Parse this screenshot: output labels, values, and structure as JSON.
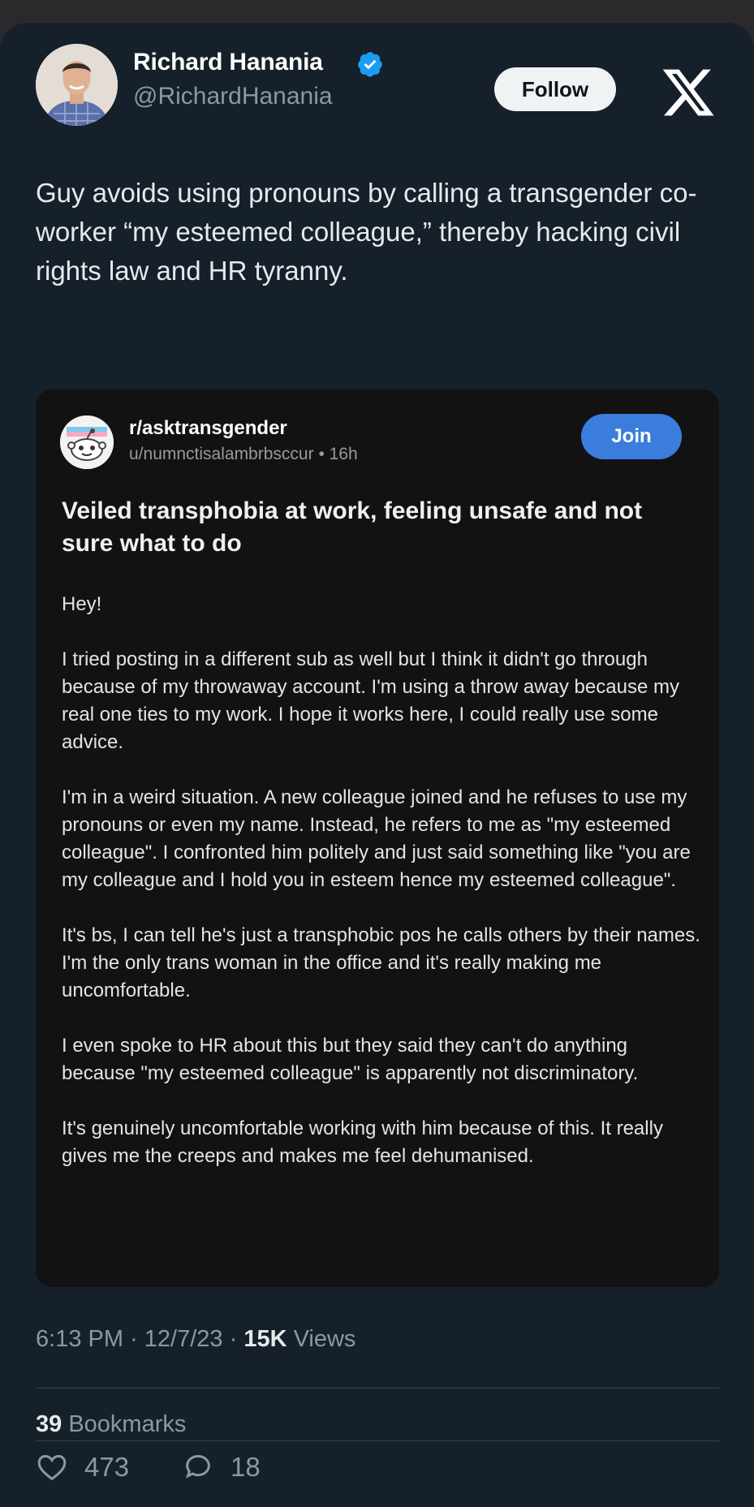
{
  "author": {
    "display_name": "Richard Hanania",
    "handle": "@RichardHanania",
    "follow_label": "Follow"
  },
  "tweet": {
    "text": "Guy avoids using pronouns by calling a transgender co-worker “my esteemed colleague,” thereby hacking civil rights law and HR tyranny."
  },
  "quoted_post": {
    "subreddit": "r/asktransgender",
    "user": "u/numnctisalambrbsccur",
    "age": "16h",
    "join_label": "Join",
    "title": "Veiled transphobia at work, feeling unsafe and not sure what to do",
    "paragraphs": [
      "Hey!",
      "I tried posting in a different sub as well but I think it didn't go through because of my throwaway account. I'm using a throw away because my real one ties to my work. I hope it works here, I could really use some advice.",
      "I'm in a weird situation. A new colleague joined and he refuses to use my pronouns or even my name. Instead, he refers to me as \"my esteemed colleague\". I confronted him politely and just said something like \"you are my colleague and I hold you in esteem hence my esteemed colleague\".",
      "It's bs, I can tell he's just a transphobic pos he calls others by their names. I'm the only trans woman in the office and it's really making me uncomfortable.",
      "I even spoke to HR about this but they said they can't do anything because \"my esteemed colleague\" is apparently not discriminatory.",
      "It's genuinely uncomfortable working with him because of this. It really gives me the creeps and makes me feel dehumanised."
    ]
  },
  "meta": {
    "time": "6:13 PM",
    "date": "12/7/23",
    "views_count": "15K",
    "views_label": "Views",
    "bookmarks_count": "39",
    "bookmarks_label": "Bookmarks"
  },
  "actions": {
    "likes": "473",
    "replies": "18"
  },
  "colors": {
    "background": "#15202b",
    "verified": "#1d9bf0",
    "join_button": "#3b7ddd"
  }
}
